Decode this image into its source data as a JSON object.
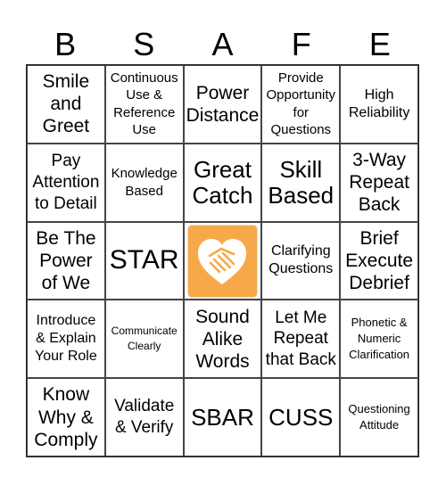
{
  "header": {
    "letters": [
      "B",
      "S",
      "A",
      "F",
      "E"
    ]
  },
  "free_space": {
    "icon": "heart-handshake-icon",
    "color": "#f7a94a"
  },
  "cells": [
    "Smile\nand\nGreet",
    "Continuous\nUse &\nReference\nUse",
    "Power\nDistance",
    "Provide\nOpportunity\nfor\nQuestions",
    "High\nReliability",
    "Pay\nAttention\nto Detail",
    "Knowledge\nBased",
    "Great\nCatch",
    "Skill\nBased",
    "3-Way\nRepeat\nBack",
    "Be The\nPower\nof We",
    "STAR",
    "",
    "Clarifying\nQuestions",
    "Brief\nExecute\nDebrief",
    "Introduce\n& Explain\nYour Role",
    "Communicate\nClearly",
    "Sound\nAlike\nWords",
    "Let Me\nRepeat\nthat Back",
    "Phonetic &\nNumeric\nClarification",
    "Know\nWhy &\nComply",
    "Validate\n& Verify",
    "SBAR",
    "CUSS",
    "Questioning\nAttitude"
  ]
}
